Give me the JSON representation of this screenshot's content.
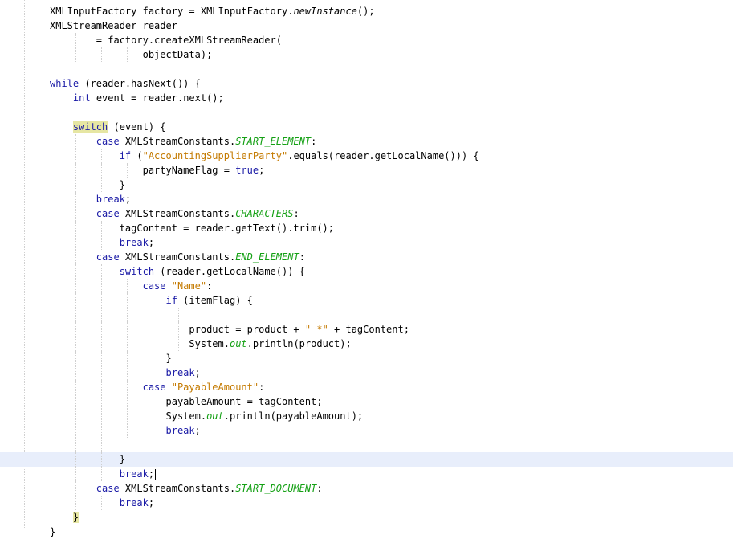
{
  "editor": {
    "current_line": 31,
    "lines": [
      {
        "t": [
          {
            "v": "XMLInputFactory factory = XMLInputFactory."
          },
          {
            "v": "newInstance",
            "c": "mi"
          },
          {
            "v": "();"
          }
        ]
      },
      {
        "t": [
          {
            "v": "XMLStreamReader reader"
          }
        ]
      },
      {
        "t": [
          {
            "v": "        = factory.createXMLStreamReader("
          }
        ]
      },
      {
        "t": [
          {
            "v": "                objectData);"
          }
        ]
      },
      {
        "t": []
      },
      {
        "t": [
          {
            "v": "while",
            "c": "kw"
          },
          {
            "v": " (reader.hasNext()) {"
          }
        ]
      },
      {
        "t": [
          {
            "v": "    "
          },
          {
            "v": "int",
            "c": "kw"
          },
          {
            "v": " event = reader.next();"
          }
        ]
      },
      {
        "t": []
      },
      {
        "t": [
          {
            "v": "    "
          },
          {
            "v": "switch",
            "c": "kw hl"
          },
          {
            "v": " (event) {"
          }
        ]
      },
      {
        "t": [
          {
            "v": "        "
          },
          {
            "v": "case",
            "c": "kw"
          },
          {
            "v": " XMLStreamConstants."
          },
          {
            "v": "START_ELEMENT",
            "c": "const"
          },
          {
            "v": ":"
          }
        ]
      },
      {
        "t": [
          {
            "v": "            "
          },
          {
            "v": "if",
            "c": "kw"
          },
          {
            "v": " ("
          },
          {
            "v": "\"AccountingSupplierParty\"",
            "c": "str"
          },
          {
            "v": ".equals(reader.getLocalName())) {"
          }
        ]
      },
      {
        "t": [
          {
            "v": "                partyNameFlag = "
          },
          {
            "v": "true",
            "c": "kw"
          },
          {
            "v": ";"
          }
        ]
      },
      {
        "t": [
          {
            "v": "            }"
          }
        ]
      },
      {
        "t": [
          {
            "v": "        "
          },
          {
            "v": "break",
            "c": "kw"
          },
          {
            "v": ";"
          }
        ]
      },
      {
        "t": [
          {
            "v": "        "
          },
          {
            "v": "case",
            "c": "kw"
          },
          {
            "v": " XMLStreamConstants."
          },
          {
            "v": "CHARACTERS",
            "c": "const"
          },
          {
            "v": ":"
          }
        ]
      },
      {
        "t": [
          {
            "v": "            tagContent = reader.getText().trim();"
          }
        ]
      },
      {
        "t": [
          {
            "v": "            "
          },
          {
            "v": "break",
            "c": "kw"
          },
          {
            "v": ";"
          }
        ]
      },
      {
        "t": [
          {
            "v": "        "
          },
          {
            "v": "case",
            "c": "kw"
          },
          {
            "v": " XMLStreamConstants."
          },
          {
            "v": "END_ELEMENT",
            "c": "const"
          },
          {
            "v": ":"
          }
        ]
      },
      {
        "t": [
          {
            "v": "            "
          },
          {
            "v": "switch",
            "c": "kw"
          },
          {
            "v": " (reader.getLocalName()) {"
          }
        ]
      },
      {
        "t": [
          {
            "v": "                "
          },
          {
            "v": "case",
            "c": "kw"
          },
          {
            "v": " "
          },
          {
            "v": "\"Name\"",
            "c": "str"
          },
          {
            "v": ":"
          }
        ]
      },
      {
        "t": [
          {
            "v": "                    "
          },
          {
            "v": "if",
            "c": "kw"
          },
          {
            "v": " (itemFlag) {"
          }
        ]
      },
      {
        "t": []
      },
      {
        "t": [
          {
            "v": "                        product = product + "
          },
          {
            "v": "\" *\"",
            "c": "str"
          },
          {
            "v": " + tagContent;"
          }
        ]
      },
      {
        "t": [
          {
            "v": "                        System."
          },
          {
            "v": "out",
            "c": "stat"
          },
          {
            "v": ".println(product);"
          }
        ]
      },
      {
        "t": [
          {
            "v": "                    }"
          }
        ]
      },
      {
        "t": [
          {
            "v": "                    "
          },
          {
            "v": "break",
            "c": "kw"
          },
          {
            "v": ";"
          }
        ]
      },
      {
        "t": [
          {
            "v": "                "
          },
          {
            "v": "case",
            "c": "kw"
          },
          {
            "v": " "
          },
          {
            "v": "\"PayableAmount\"",
            "c": "str"
          },
          {
            "v": ":"
          }
        ]
      },
      {
        "t": [
          {
            "v": "                    payableAmount = tagContent;"
          }
        ]
      },
      {
        "t": [
          {
            "v": "                    System."
          },
          {
            "v": "out",
            "c": "stat"
          },
          {
            "v": ".println(payableAmount);"
          }
        ]
      },
      {
        "t": [
          {
            "v": "                    "
          },
          {
            "v": "break",
            "c": "kw"
          },
          {
            "v": ";"
          }
        ]
      },
      {
        "t": []
      },
      {
        "t": [
          {
            "v": "            }"
          }
        ]
      },
      {
        "t": [
          {
            "v": "            "
          },
          {
            "v": "break",
            "c": "kw"
          },
          {
            "v": ";"
          }
        ],
        "caret": true
      },
      {
        "t": [
          {
            "v": "        "
          },
          {
            "v": "case",
            "c": "kw"
          },
          {
            "v": " XMLStreamConstants."
          },
          {
            "v": "START_DOCUMENT",
            "c": "const"
          },
          {
            "v": ":"
          }
        ]
      },
      {
        "t": [
          {
            "v": "            "
          },
          {
            "v": "break",
            "c": "kw"
          },
          {
            "v": ";"
          }
        ]
      },
      {
        "t": [
          {
            "v": "    "
          },
          {
            "v": "}",
            "c": "hl"
          }
        ]
      },
      {
        "t": [
          {
            "v": "}"
          }
        ]
      }
    ]
  }
}
